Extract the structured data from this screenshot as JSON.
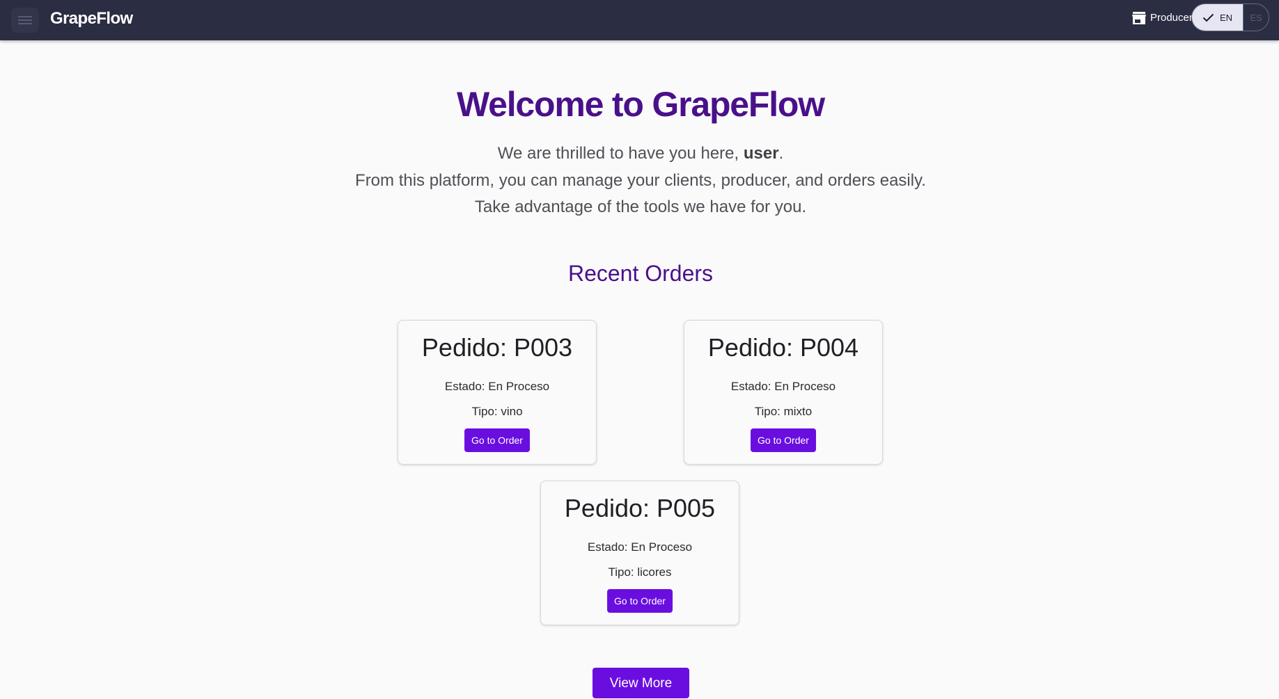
{
  "header": {
    "menu_icon": "hamburger-menu-icon",
    "brand": "GrapeFlow",
    "producer_icon": "store-icon",
    "producer_label": "Producer",
    "languages": [
      {
        "label": "EN",
        "selected": true,
        "icon": "check-icon"
      },
      {
        "label": "ES",
        "selected": false
      }
    ]
  },
  "welcome": {
    "title": "Welcome to GrapeFlow",
    "line1_prefix": "We are thrilled to have you here, ",
    "username": "user",
    "line1_suffix": ".",
    "line2": "From this platform, you can manage your clients, producer, and orders easily.",
    "line3": "Take advantage of the tools we have for you."
  },
  "recent_orders": {
    "title": "Recent Orders",
    "orders": [
      {
        "title": "Pedido: P003",
        "status": "Estado: En Proceso",
        "type": "Tipo: vino",
        "button": "Go to Order"
      },
      {
        "title": "Pedido: P004",
        "status": "Estado: En Proceso",
        "type": "Tipo: mixto",
        "button": "Go to Order"
      },
      {
        "title": "Pedido: P005",
        "status": "Estado: En Proceso",
        "type": "Tipo: licores",
        "button": "Go to Order"
      }
    ],
    "view_more": "View More"
  },
  "colors": {
    "topbar_bg": "#2b2d42",
    "accent_purple": "#6a0ee0",
    "heading_purple": "#4a108a",
    "page_bg": "#fafafb"
  }
}
